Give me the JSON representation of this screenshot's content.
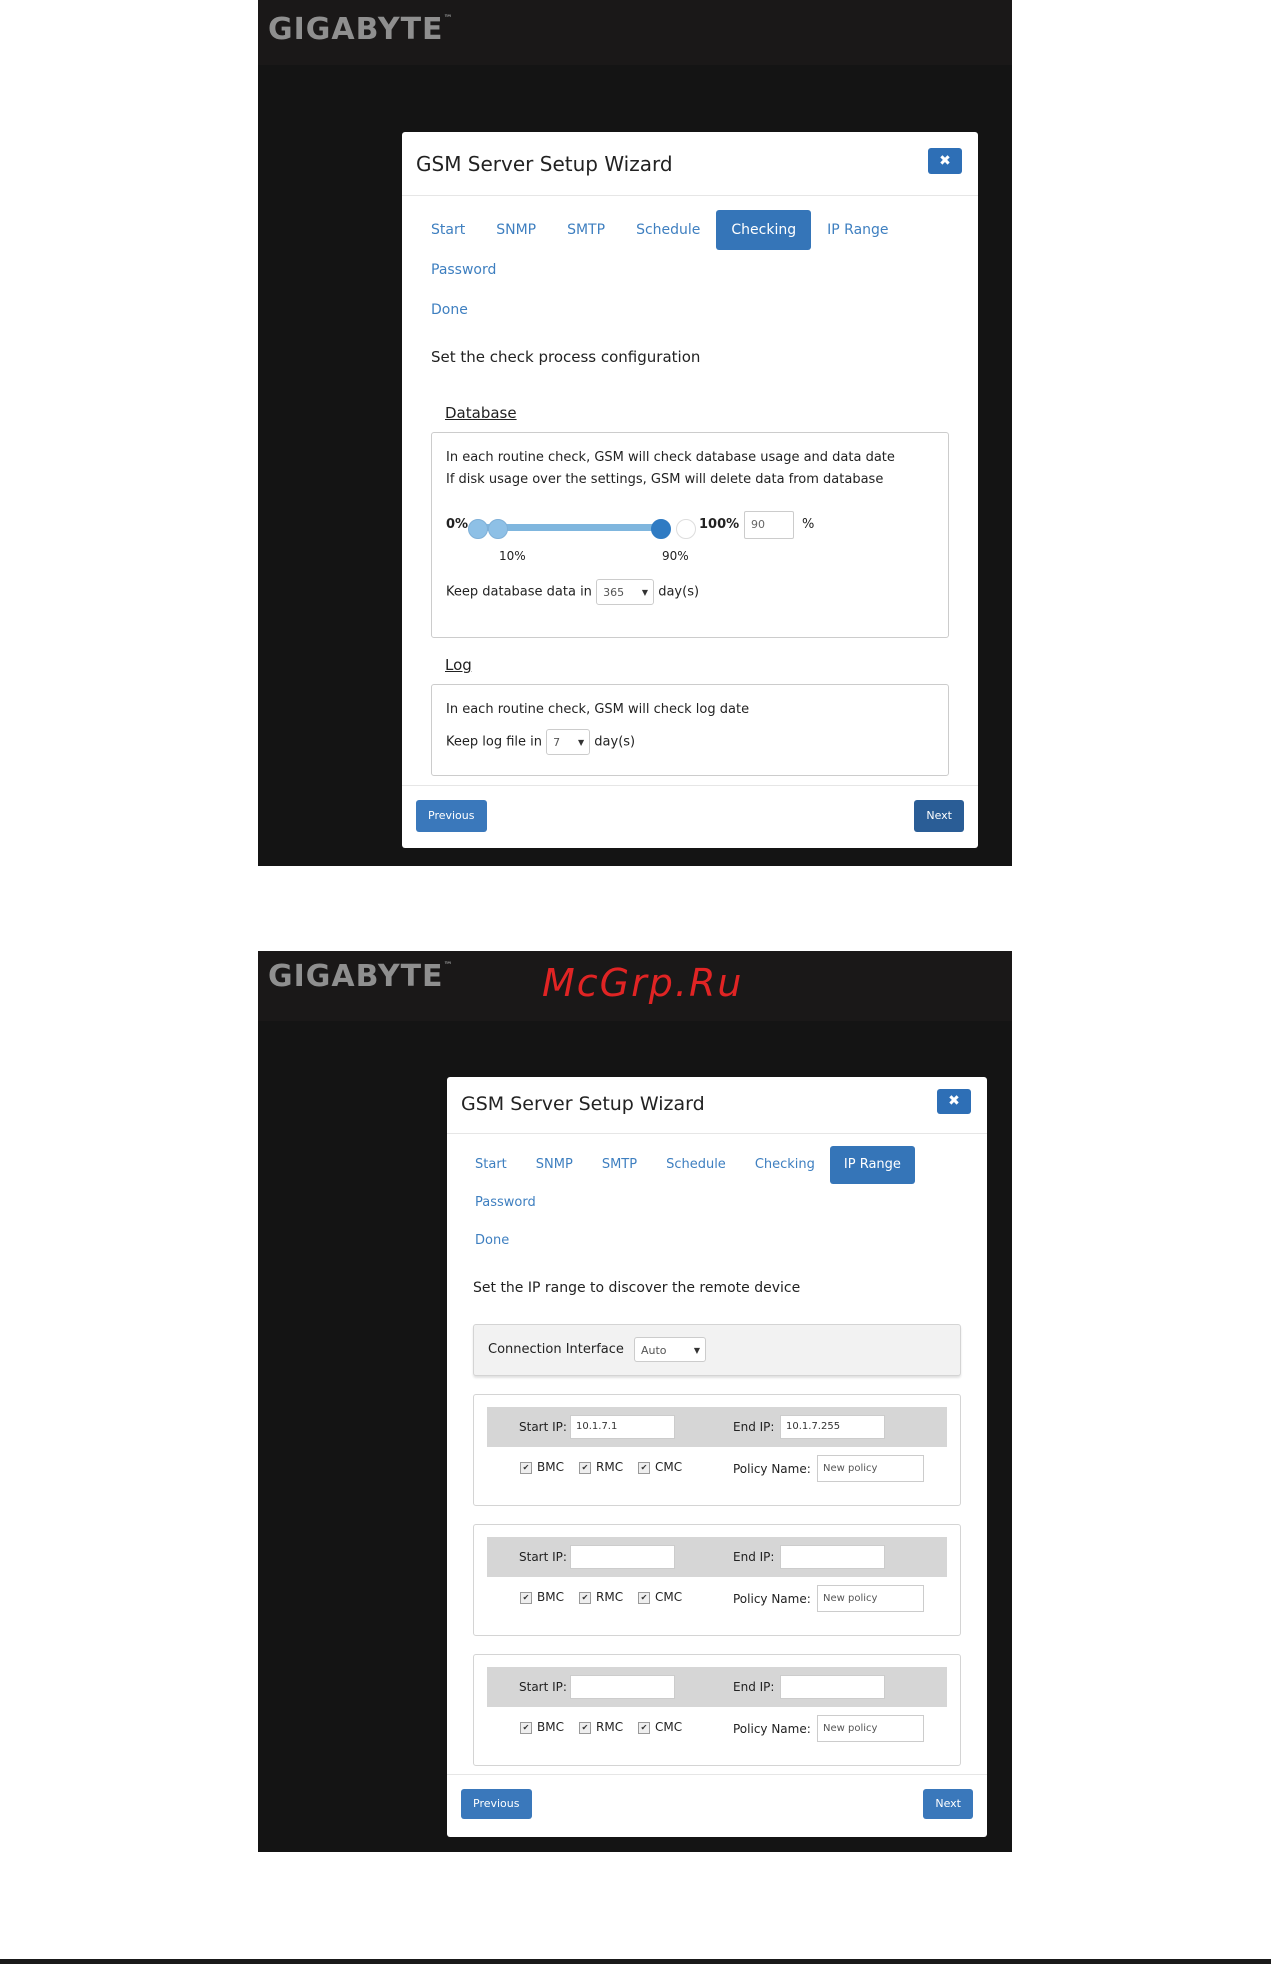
{
  "brand": {
    "logo": "GIGABYTE",
    "tm": "™"
  },
  "watermark": "McGrp.Ru",
  "wizard1": {
    "title": "GSM Server Setup Wizard",
    "close": "✖",
    "tabs": [
      "Start",
      "SNMP",
      "SMTP",
      "Schedule",
      "Checking",
      "IP Range",
      "Password",
      "Done"
    ],
    "active_tab": "Checking",
    "intro": "Set the check process configuration",
    "database": {
      "title": "Database",
      "line1": "In each routine check, GSM will check database usage and data date",
      "line2": "If disk usage over the settings, GSM will delete data from database",
      "min_label": "0%",
      "max_label": "100%",
      "low_tick": "10%",
      "high_tick": "90%",
      "low_value": 10,
      "high_value": 90,
      "percent_value": "90",
      "percent_unit": "%",
      "keep_label": "Keep database data in",
      "keep_value": "365",
      "keep_unit": "day(s)"
    },
    "log": {
      "title": "Log",
      "line1": "In each routine check, GSM will check log date",
      "keep_label": "Keep log file in",
      "keep_value": "7",
      "keep_unit": "day(s)"
    },
    "previous": "Previous",
    "next": "Next"
  },
  "wizard2": {
    "title": "GSM Server Setup Wizard",
    "close": "✖",
    "tabs": [
      "Start",
      "SNMP",
      "SMTP",
      "Schedule",
      "Checking",
      "IP Range",
      "Password",
      "Done"
    ],
    "active_tab": "IP Range",
    "intro": "Set the IP range to discover the remote device",
    "connection_label": "Connection Interface",
    "connection_value": "Auto",
    "start_label": "Start IP:",
    "end_label": "End IP:",
    "policy_label": "Policy Name:",
    "ranges": [
      {
        "start": "10.1.7.1",
        "end": "10.1.7.255",
        "policy": "New policy",
        "bmc": "BMC",
        "rmc": "RMC",
        "cmc": "CMC"
      },
      {
        "start": "",
        "end": "",
        "policy": "New policy",
        "bmc": "BMC",
        "rmc": "RMC",
        "cmc": "CMC"
      },
      {
        "start": "",
        "end": "",
        "policy": "New policy",
        "bmc": "BMC",
        "rmc": "RMC",
        "cmc": "CMC"
      }
    ],
    "check_mark": "✔",
    "previous": "Previous",
    "next": "Next"
  }
}
